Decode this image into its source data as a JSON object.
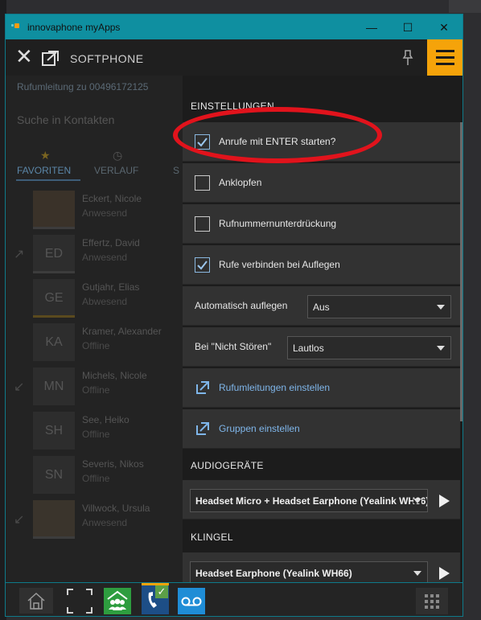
{
  "window": {
    "title": "innovaphone myApps",
    "minimize": "—",
    "maximize": "☐",
    "close": "✕"
  },
  "appbar": {
    "close_glyph": "✕",
    "app_name": "SOFTPHONE",
    "pin_glyph": "⚲"
  },
  "background": {
    "redirect_text": "Rufumleitung zu 00496172125",
    "search_placeholder": "Suche in Kontakten",
    "tabs": [
      "FAVORITEN",
      "VERLAUF",
      "S"
    ],
    "contacts": [
      {
        "name": "Eckert, Nicole",
        "status": "Anwesend",
        "initials": ""
      },
      {
        "name": "Effertz, David",
        "status": "Anwesend",
        "initials": "ED"
      },
      {
        "name": "Gutjahr, Elias",
        "status": "Abwesend",
        "initials": "GE"
      },
      {
        "name": "Kramer, Alexander",
        "status": "Offline",
        "initials": "KA"
      },
      {
        "name": "Michels, Nicole",
        "status": "Offline",
        "initials": "MN"
      },
      {
        "name": "See, Heiko",
        "status": "Offline",
        "initials": "SH"
      },
      {
        "name": "Severis, Nikos",
        "status": "Offline",
        "initials": "SN"
      },
      {
        "name": "Villwock, Ursula",
        "status": "Anwesend",
        "initials": ""
      }
    ]
  },
  "settings": {
    "section_title": "EINSTELLUNGEN",
    "enter_call": {
      "label": "Anrufe mit ENTER starten?",
      "checked": true
    },
    "call_waiting": {
      "label": "Anklopfen",
      "checked": false
    },
    "hide_number": {
      "label": "Rufnummernunterdrückung",
      "checked": false
    },
    "connect_on_hangup": {
      "label": "Rufe verbinden bei Auflegen",
      "checked": true
    },
    "auto_hangup": {
      "label": "Automatisch auflegen",
      "value": "Aus"
    },
    "dnd": {
      "label": "Bei \"Nicht Stören\"",
      "value": "Lautlos"
    },
    "redirect_link": "Rufumleitungen einstellen",
    "groups_link": "Gruppen einstellen"
  },
  "audio": {
    "section_title": "AUDIOGERÄTE",
    "device": "Headset Micro + Headset Earphone (Yealink WH66)"
  },
  "ring": {
    "section_title": "KLINGEL",
    "device": "Headset Earphone (Yealink WH66)"
  },
  "dock": {
    "home_icon": "home-icon",
    "fullscreen_icon": "fullscreen-icon",
    "groups_icon": "groups-icon",
    "phone_icon": "phone-icon",
    "voicemail_icon": "voicemail-icon",
    "apps_icon": "grid-icon"
  },
  "colors": {
    "titlebar": "#0f8fa0",
    "menu_accent": "#f5a30a",
    "link": "#7fb6ea",
    "highlight_oval": "#e1131c",
    "groups_app": "#2e9d3f",
    "voicemail_app": "#1f8dd6",
    "phone_app": "#1d4e86"
  }
}
